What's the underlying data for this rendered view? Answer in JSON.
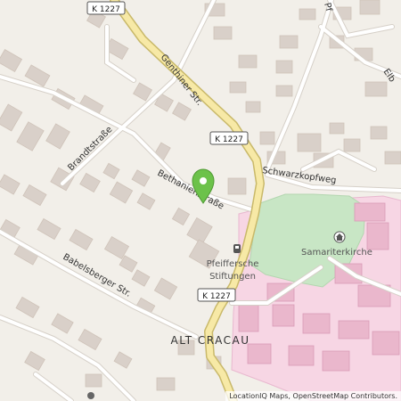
{
  "map": {
    "streets": {
      "genthiner": "Genthiner Str.",
      "brandt": "Brandtstraße",
      "bethanien": "Bethanienstraße",
      "babelsberger": "Babelsberger Str.",
      "schwarzkopf": "Schwarzkopfweg",
      "elb_partial": "Elb",
      "pf_partial": "Pf"
    },
    "road_refs": {
      "top": "K 1227",
      "middle": "K 1227",
      "lower": "K 1227"
    },
    "pois": {
      "church": "Samariterkirche",
      "stiftungen_line1": "Pfeiffersche",
      "stiftungen_line2": "Stiftungen"
    },
    "district": "ALT CRACAU",
    "icons": {
      "pin": "location-pin-icon",
      "church": "church-icon",
      "tram": "tram-stop-icon",
      "bottom": "poi-icon"
    },
    "colors": {
      "background": "#f2efe9",
      "building": "#d9d0c9",
      "park": "#c8e6c5",
      "hospital": "#f7d6e4",
      "main_road": "#f7e9a6",
      "road_casing": "#c9b96a",
      "pin": "#6cc24a"
    }
  },
  "attribution": "LocationIQ Maps, OpenStreetMap Contributors."
}
